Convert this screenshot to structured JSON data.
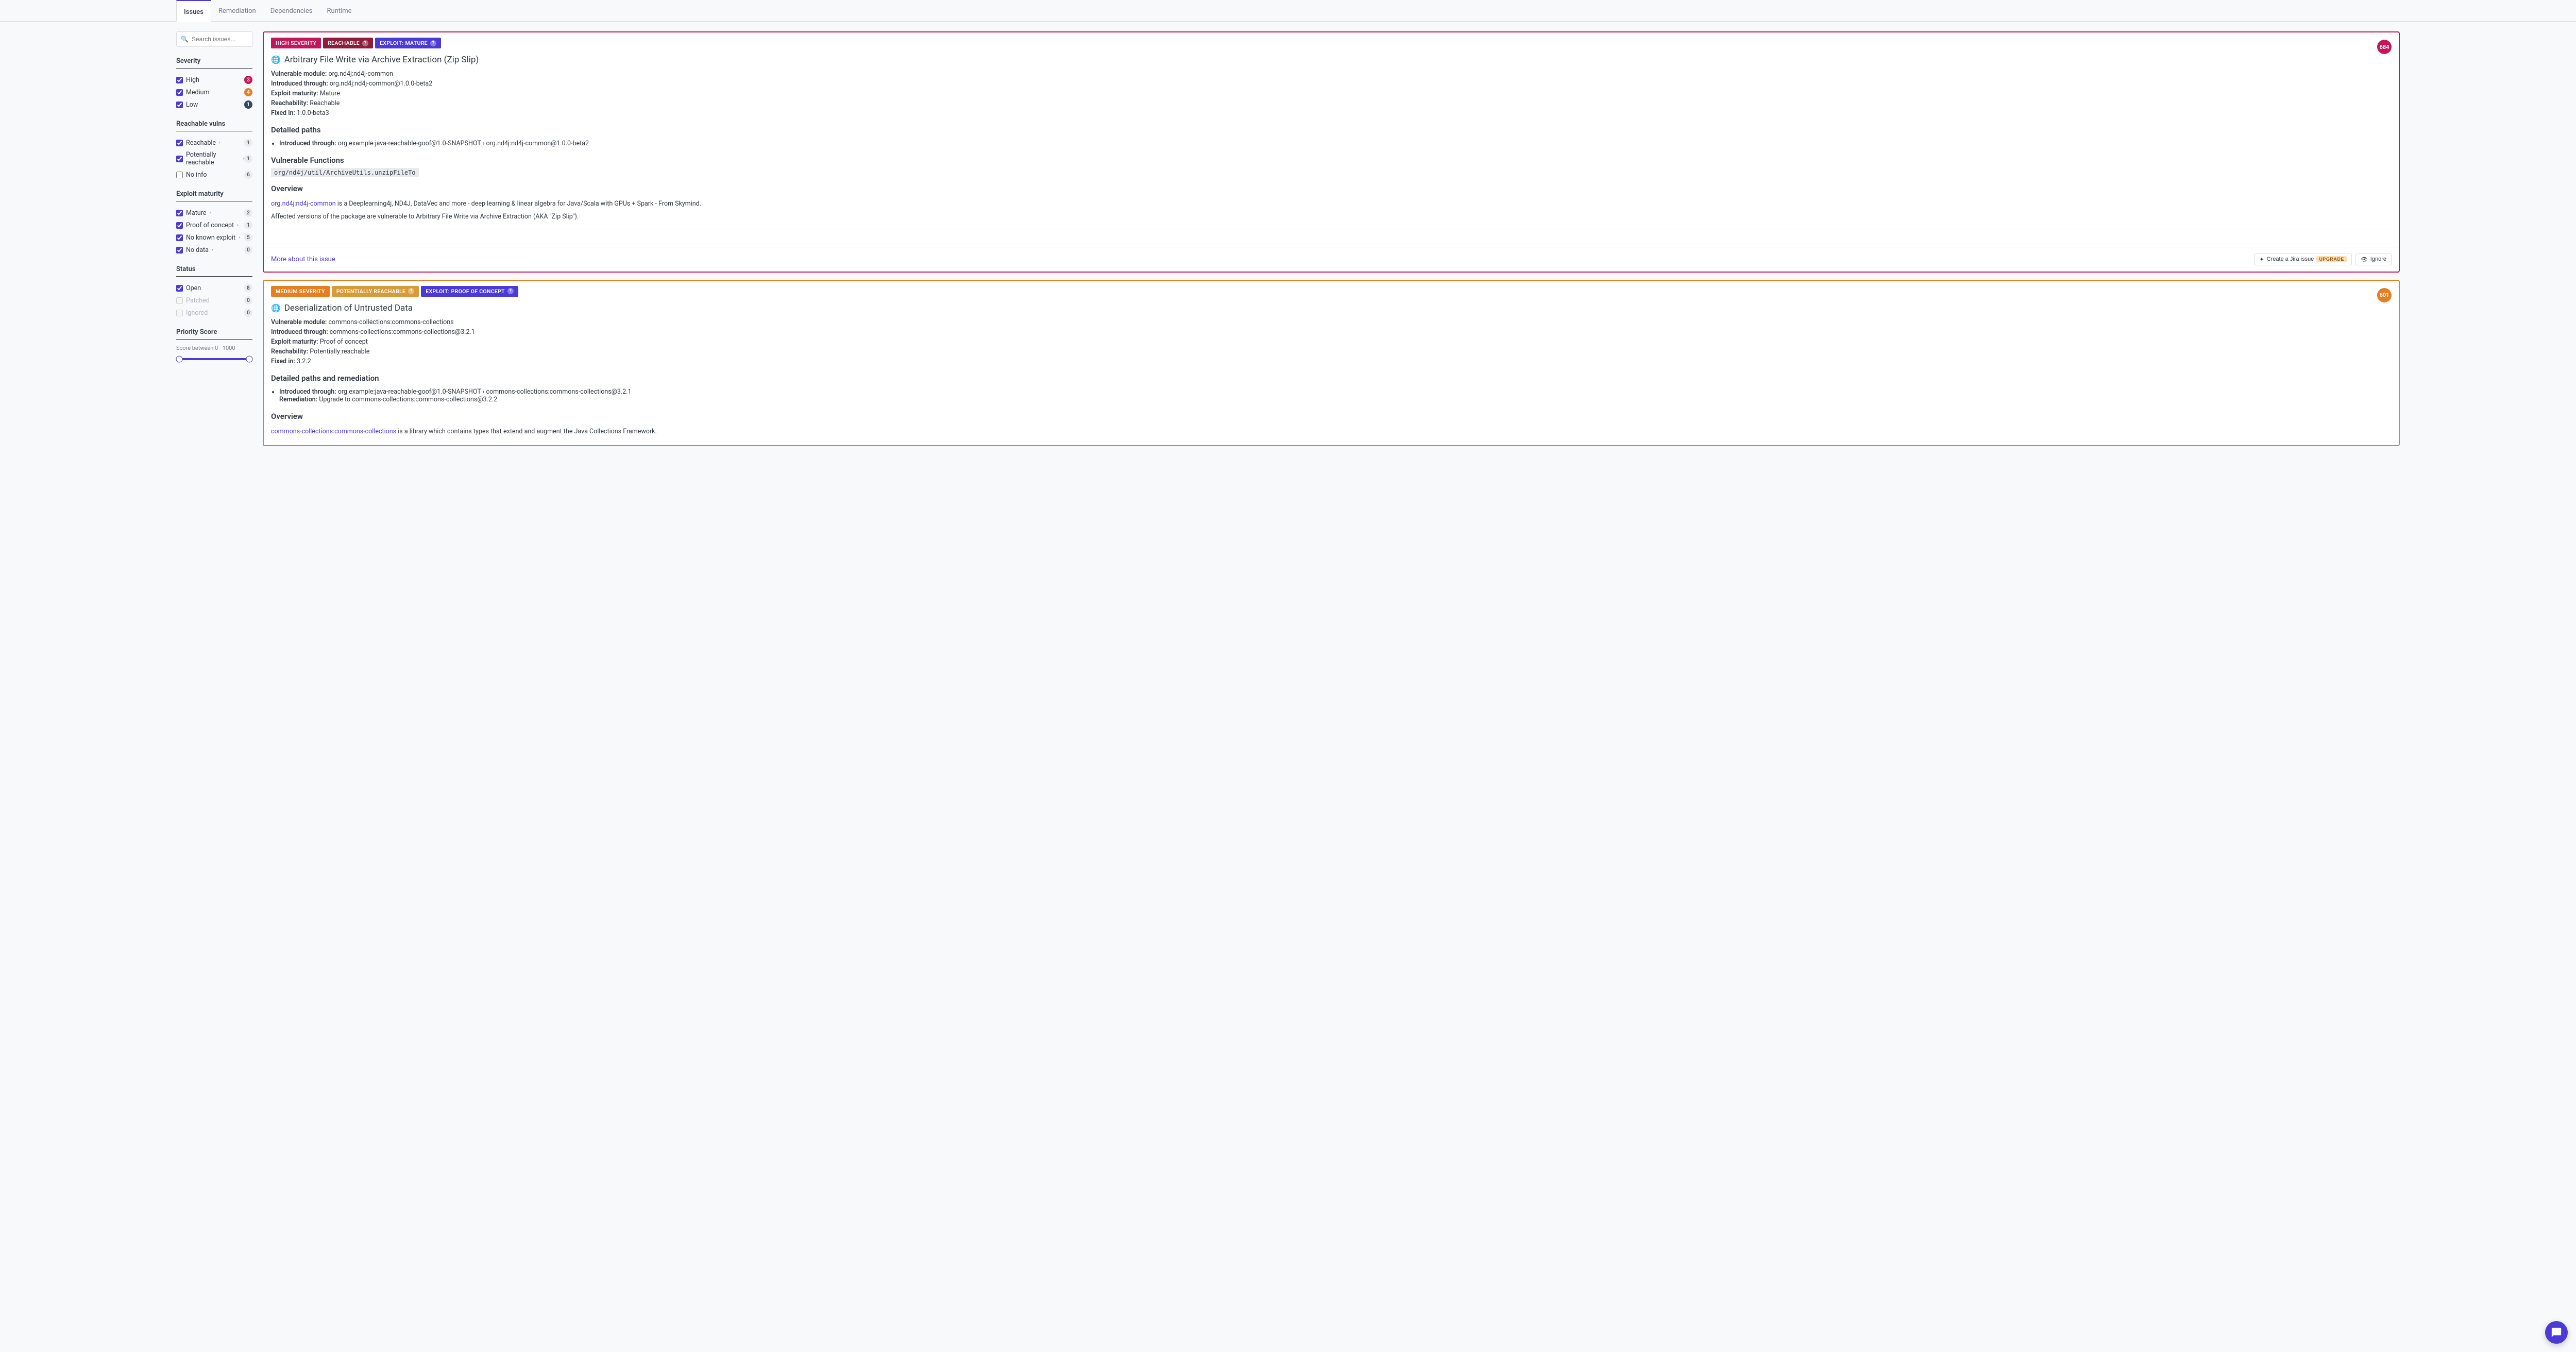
{
  "tabs": {
    "issues": "Issues",
    "remediation": "Remediation",
    "dependencies": "Dependencies",
    "runtime": "Runtime"
  },
  "search": {
    "placeholder": "Search issues..."
  },
  "filters": {
    "severity": {
      "title": "Severity",
      "high": "High",
      "high_count": "3",
      "medium": "Medium",
      "medium_count": "4",
      "low": "Low",
      "low_count": "1"
    },
    "reachable": {
      "title": "Reachable vulns",
      "reachable": "Reachable",
      "reachable_count": "1",
      "potentially": "Potentially reachable",
      "potentially_count": "1",
      "noinfo": "No info",
      "noinfo_count": "6"
    },
    "exploit": {
      "title": "Exploit maturity",
      "mature": "Mature",
      "mature_count": "2",
      "poc": "Proof of concept",
      "poc_count": "1",
      "nke": "No known exploit",
      "nke_count": "5",
      "nodata": "No data",
      "nodata_count": "0"
    },
    "status": {
      "title": "Status",
      "open": "Open",
      "open_count": "8",
      "patched": "Patched",
      "patched_count": "0",
      "ignored": "Ignored",
      "ignored_count": "0"
    },
    "priority": {
      "title": "Priority Score",
      "sub": "Score between 0 - 1000"
    }
  },
  "issue1": {
    "score": "684",
    "sev_pill": "HIGH SEVERITY",
    "reach_pill": "REACHABLE",
    "exploit_pill": "EXPLOIT: MATURE",
    "title": "Arbitrary File Write via Archive Extraction (Zip Slip)",
    "vuln_module_label": "Vulnerable module:",
    "vuln_module": "org.nd4j:nd4j-common",
    "intro_label": "Introduced through:",
    "intro": "org.nd4j:nd4j-common@1.0.0-beta2",
    "exploit_label": "Exploit maturity:",
    "exploit": "Mature",
    "reach_label": "Reachability:",
    "reach": "Reachable",
    "fixed_label": "Fixed in:",
    "fixed": "1.0.0-beta3",
    "detailed_paths_h": "Detailed paths",
    "path_intro_label": "Introduced through:",
    "path_intro": "org.example:java-reachable-goof@1.0-SNAPSHOT › org.nd4j:nd4j-common@1.0.0-beta2",
    "vuln_funcs_h": "Vulnerable Functions",
    "func": "org/nd4j/util/ArchiveUtils.unzipFileTo",
    "overview_h": "Overview",
    "ov_link": "org.nd4j:nd4j-common",
    "ov_text1": " is a Deeplearning4j, ND4J, DataVec and more - deep learning & linear algebra for Java/Scala with GPUs + Spark - From Skymind.",
    "ov_text2": "Affected versions of the package are vulnerable to Arbitrary File Write via Archive Extraction (AKA \"Zip Slip\").",
    "more_link": "More about this issue",
    "jira_btn": "Create a Jira issue",
    "upgrade": "UPGRADE",
    "ignore_btn": "Ignore"
  },
  "issue2": {
    "score": "601",
    "sev_pill": "MEDIUM SEVERITY",
    "reach_pill": "POTENTIALLY REACHABLE",
    "exploit_pill": "EXPLOIT: PROOF OF CONCEPT",
    "title": "Deserialization of Untrusted Data",
    "vuln_module_label": "Vulnerable module:",
    "vuln_module": "commons-collections:commons-collections",
    "intro_label": "Introduced through:",
    "intro": "commons-collections:commons-collections@3.2.1",
    "exploit_label": "Exploit maturity:",
    "exploit": "Proof of concept",
    "reach_label": "Reachability:",
    "reach": "Potentially reachable",
    "fixed_label": "Fixed in:",
    "fixed": "3.2.2",
    "detailed_paths_h": "Detailed paths and remediation",
    "path_intro_label": "Introduced through:",
    "path_intro": "org.example:java-reachable-goof@1.0-SNAPSHOT › commons-collections:commons-collections@3.2.1",
    "remediation_label": "Remediation:",
    "remediation": "Upgrade to commons-collections:commons-collections@3.2.2",
    "overview_h": "Overview",
    "ov_link": "commons-collections:commons-collections",
    "ov_text1": " is a library which contains types that extend and augment the Java Collections Framework."
  }
}
